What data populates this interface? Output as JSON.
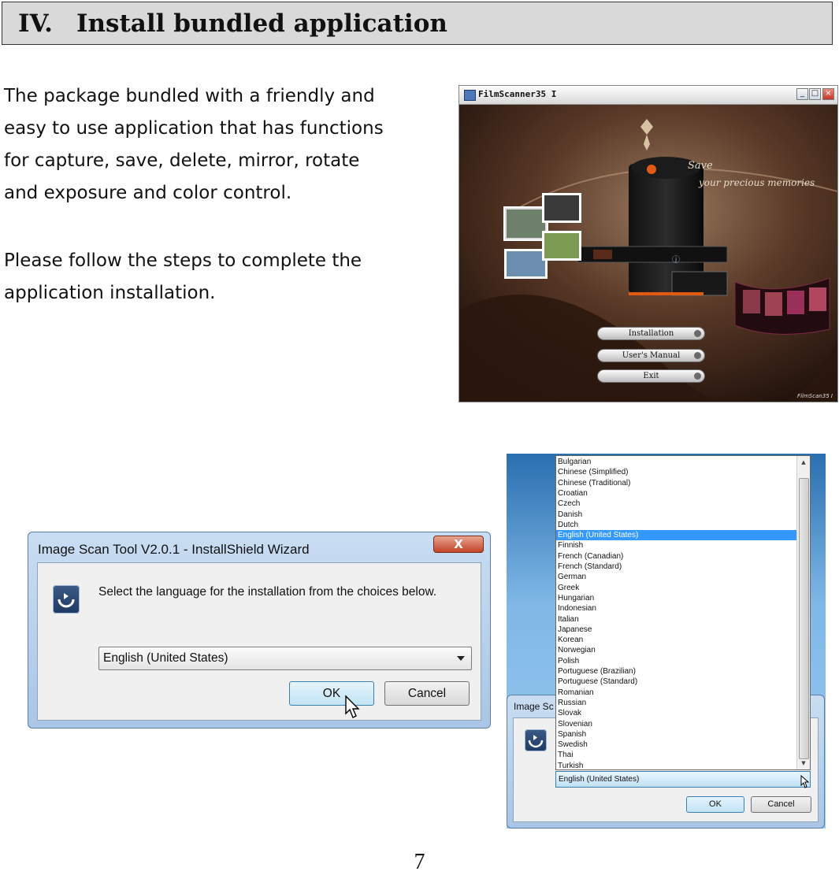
{
  "section": {
    "number": "IV.",
    "title": "Install bundled application"
  },
  "paragraphs": {
    "intro_lines": [
      "The package bundled with a friendly and",
      "easy to use application that has functions",
      "for capture, save, delete, mirror, rotate",
      "and exposure and color control."
    ],
    "steps_lines": [
      "Please follow the steps to complete the",
      "application installation."
    ]
  },
  "filmscanner_window": {
    "title": "FilmScanner35 I",
    "slogan_line1": "Save",
    "slogan_line2": "your precious memories",
    "menu": {
      "installation": "Installation",
      "users_manual": "User's Manual",
      "exit": "Exit"
    },
    "logo": "FilmScan35 I",
    "colors": {
      "background": "#3b2318",
      "accent": "#e05a12"
    }
  },
  "install_dialog": {
    "title": "Image Scan Tool V2.0.1 - InstallShield Wizard",
    "close_label": "X",
    "message": "Select the language for the installation from the choices below.",
    "selected_language": "English (United States)",
    "ok_label": "OK",
    "cancel_label": "Cancel"
  },
  "language_dropdown": {
    "dialog_title_partial": "Image Sc",
    "selected": "English (United States)",
    "selected_index": 7,
    "options": [
      "Bulgarian",
      "Chinese (Simplified)",
      "Chinese (Traditional)",
      "Croatian",
      "Czech",
      "Danish",
      "Dutch",
      "English (United States)",
      "Finnish",
      "French (Canadian)",
      "French (Standard)",
      "German",
      "Greek",
      "Hungarian",
      "Indonesian",
      "Italian",
      "Japanese",
      "Korean",
      "Norwegian",
      "Polish",
      "Portuguese (Brazilian)",
      "Portuguese (Standard)",
      "Romanian",
      "Russian",
      "Slovak",
      "Slovenian",
      "Spanish",
      "Swedish",
      "Thai",
      "Turkish"
    ],
    "ok_label": "OK",
    "cancel_label": "Cancel"
  },
  "page_number": "7"
}
